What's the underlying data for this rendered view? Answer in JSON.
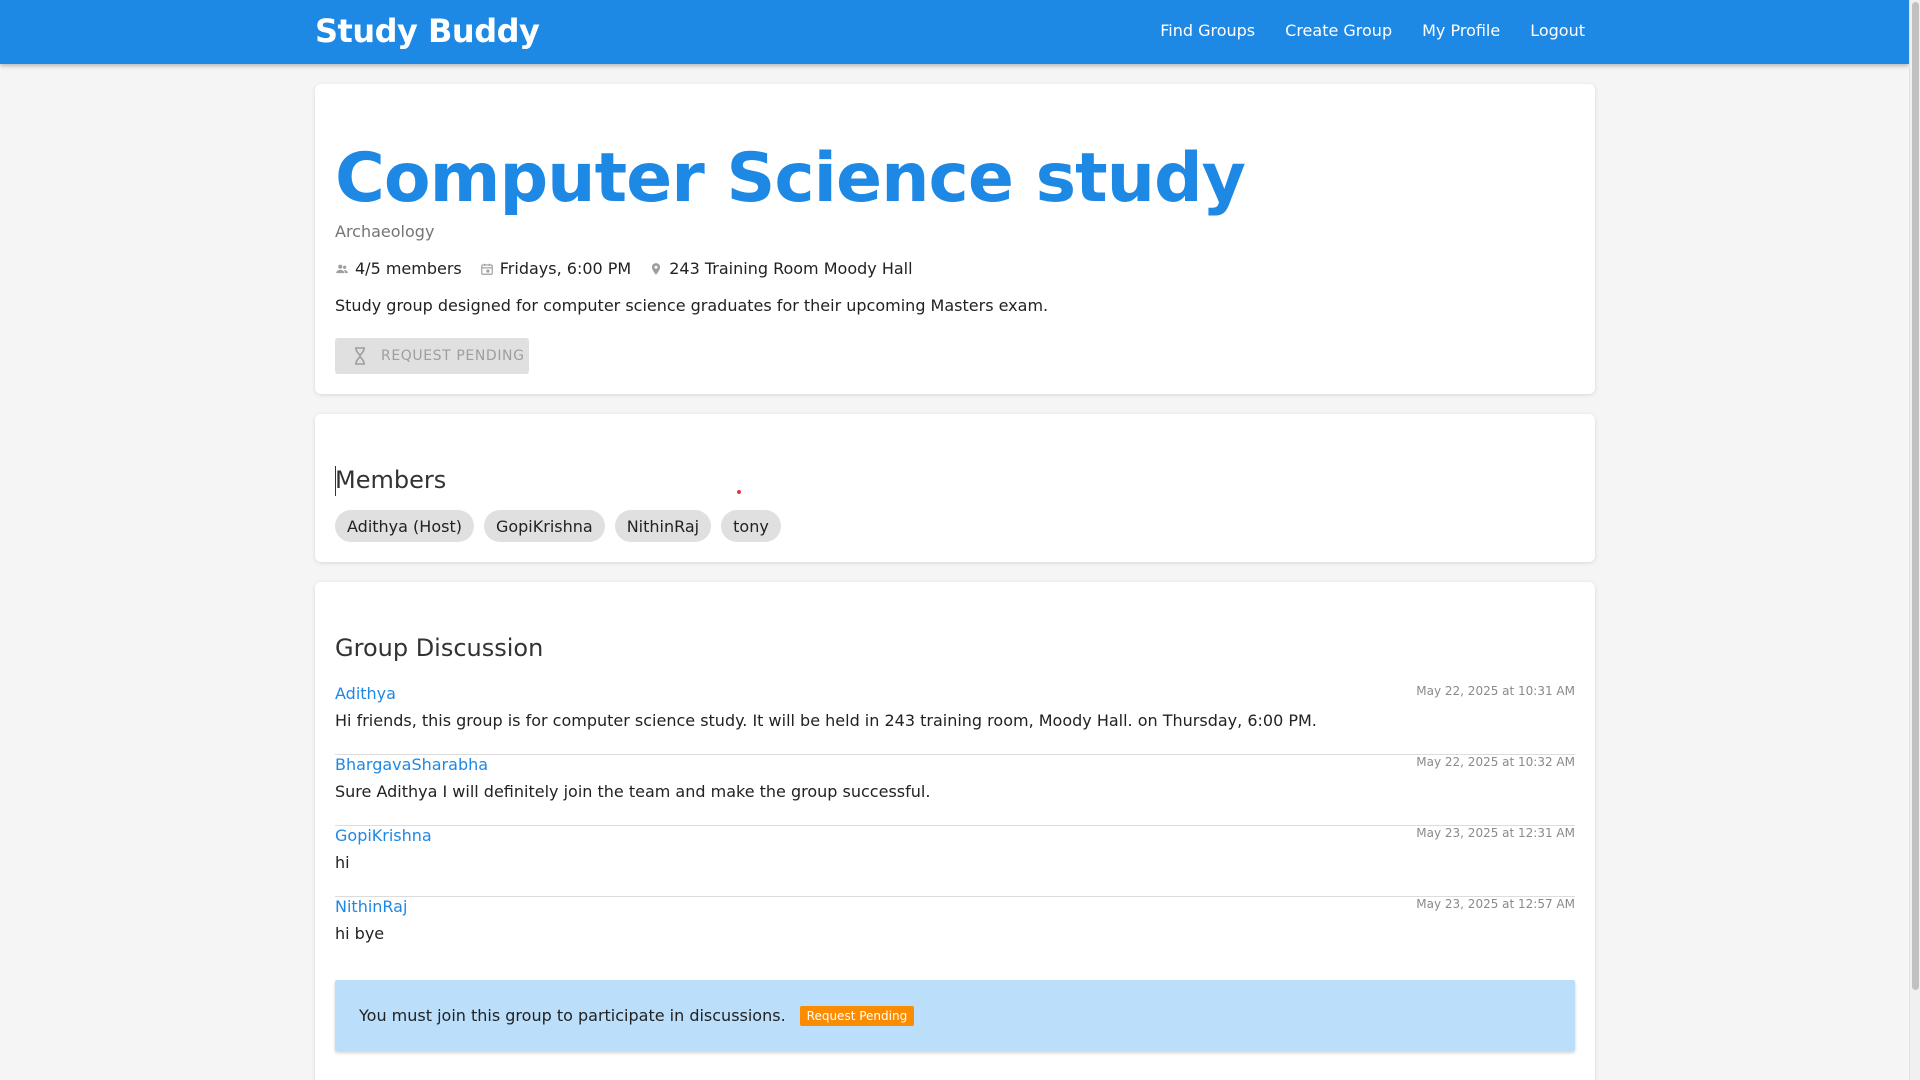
{
  "header": {
    "brand": "Study Buddy",
    "nav": [
      "Find Groups",
      "Create Group",
      "My Profile",
      "Logout"
    ]
  },
  "group": {
    "title": "Computer Science study",
    "subject": "Archaeology",
    "members_count": "4/5 members",
    "schedule": "Fridays, 6:00 PM",
    "location": "243 Training Room Moody Hall",
    "description": "Study group designed for computer science graduates for their upcoming Masters exam.",
    "request_button": "REQUEST PENDING"
  },
  "members": {
    "title": "Members",
    "list": [
      "Adithya (Host)",
      "GopiKrishna",
      "NithinRaj",
      "tony"
    ]
  },
  "discussion": {
    "title": "Group Discussion",
    "messages": [
      {
        "author": "Adithya",
        "time": "May 22, 2025 at 10:31 AM",
        "text": "Hi friends, this group is for computer science study. It will be held in 243 training room, Moody Hall. on Thursday, 6:00 PM."
      },
      {
        "author": "BhargavaSharabha",
        "time": "May 22, 2025 at 10:32 AM",
        "text": "Sure Adithya I will definitely join the team and make the group successful."
      },
      {
        "author": "GopiKrishna",
        "time": "May 23, 2025 at 12:31 AM",
        "text": "hi"
      },
      {
        "author": "NithinRaj",
        "time": "May 23, 2025 at 12:57 AM",
        "text": "hi bye"
      }
    ],
    "notice": "You must join this group to participate in discussions.",
    "notice_badge": "Request Pending"
  },
  "colors": {
    "primary": "#1e88e5",
    "notice_bg": "#bbdefb",
    "badge": "#fb8c00"
  },
  "icons": [
    "people-icon",
    "calendar-icon",
    "location-pin-icon",
    "hourglass-icon"
  ]
}
